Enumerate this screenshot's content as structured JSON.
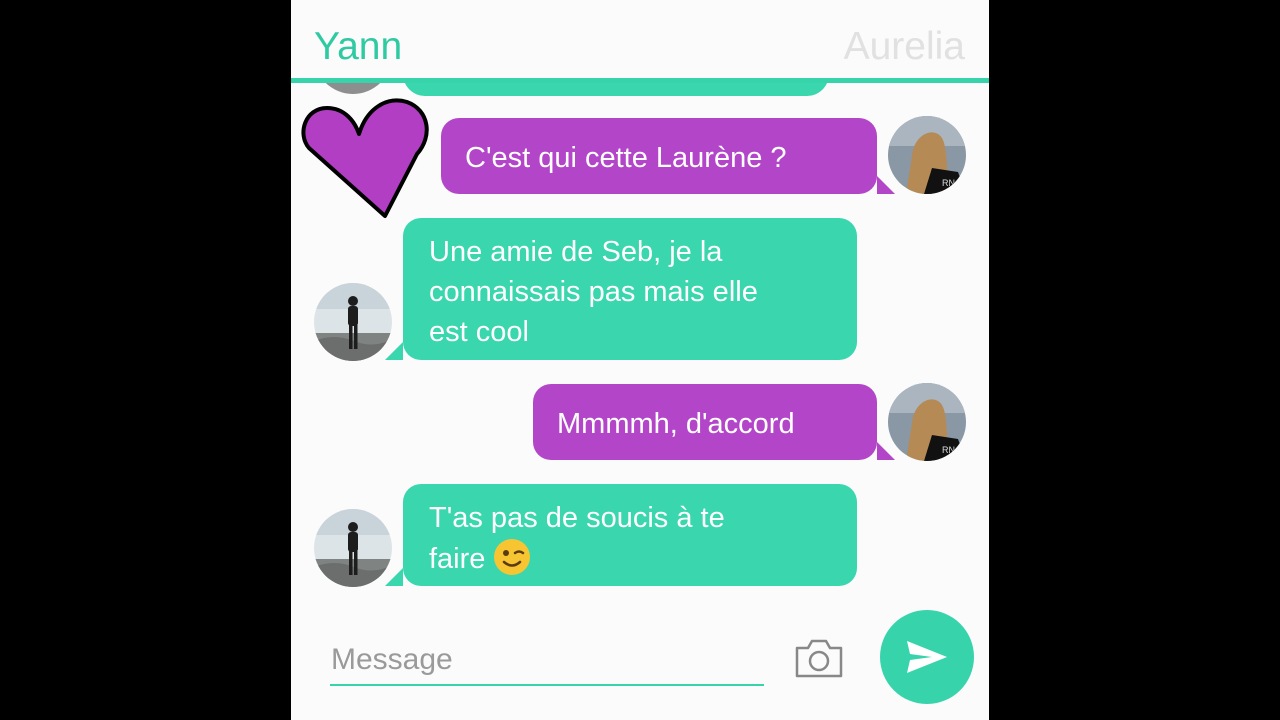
{
  "header": {
    "left_name": "Yann",
    "right_name": "Aurelia"
  },
  "messages": [
    {
      "sender": "Aurelia",
      "side": "right",
      "text": "C'est qui cette Laurène ?"
    },
    {
      "sender": "Yann",
      "side": "left",
      "lines": [
        "Une amie de Seb, je la",
        "connaissais pas mais elle",
        "est cool"
      ]
    },
    {
      "sender": "Aurelia",
      "side": "right",
      "text": "Mmmmh, d'accord"
    },
    {
      "sender": "Yann",
      "side": "left",
      "lines": [
        "T'as pas de soucis à te",
        "faire"
      ],
      "emoji": "winking-face"
    }
  ],
  "composer": {
    "placeholder": "Message"
  },
  "colors": {
    "green": "#3ad6ae",
    "purple": "#b346c8",
    "heart": "#b23ec4"
  },
  "icons": [
    "heart-icon",
    "camera-icon",
    "send-icon",
    "winking-face-emoji"
  ]
}
